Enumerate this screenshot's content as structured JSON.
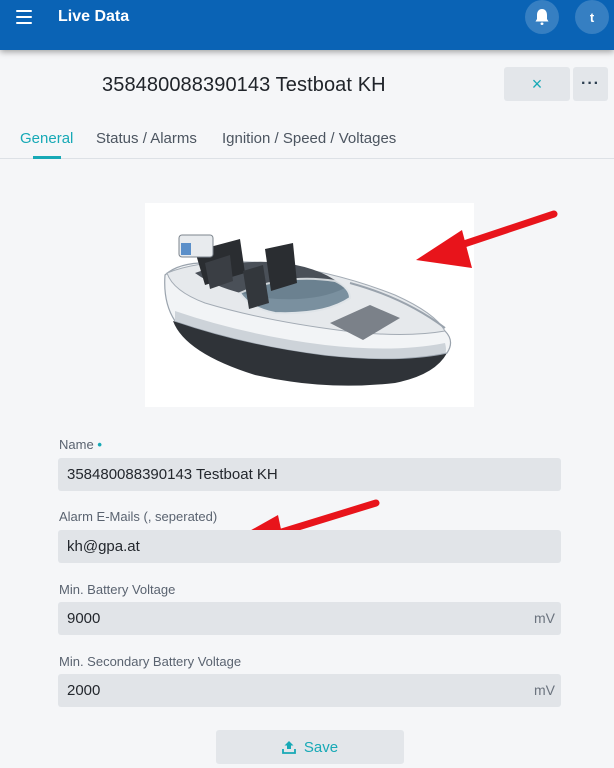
{
  "appbar": {
    "title": "Live Data",
    "avatar_initial": "t"
  },
  "header": {
    "title": "358480088390143 Testboat KH",
    "close_label": "×",
    "more_label": "···"
  },
  "tabs": [
    {
      "label": "General",
      "active": true
    },
    {
      "label": "Status / Alarms"
    },
    {
      "label": "Ignition / Speed / Voltages"
    }
  ],
  "form": {
    "name_label": "Name",
    "name_required_marker": "•",
    "name_value": "358480088390143 Testboat KH",
    "emails_label": "Alarm E-Mails (, seperated)",
    "emails_value": "kh@gpa.at",
    "battery_label": "Min. Battery Voltage",
    "battery_value": "9000",
    "battery_unit": "mV",
    "secondary_label": "Min. Secondary Battery Voltage",
    "secondary_value": "2000",
    "secondary_unit": "mV"
  },
  "save": {
    "label": "Save"
  },
  "colors": {
    "appbar": "#0a63b5",
    "accent": "#17a9b6",
    "annotation": "#e8141b"
  }
}
